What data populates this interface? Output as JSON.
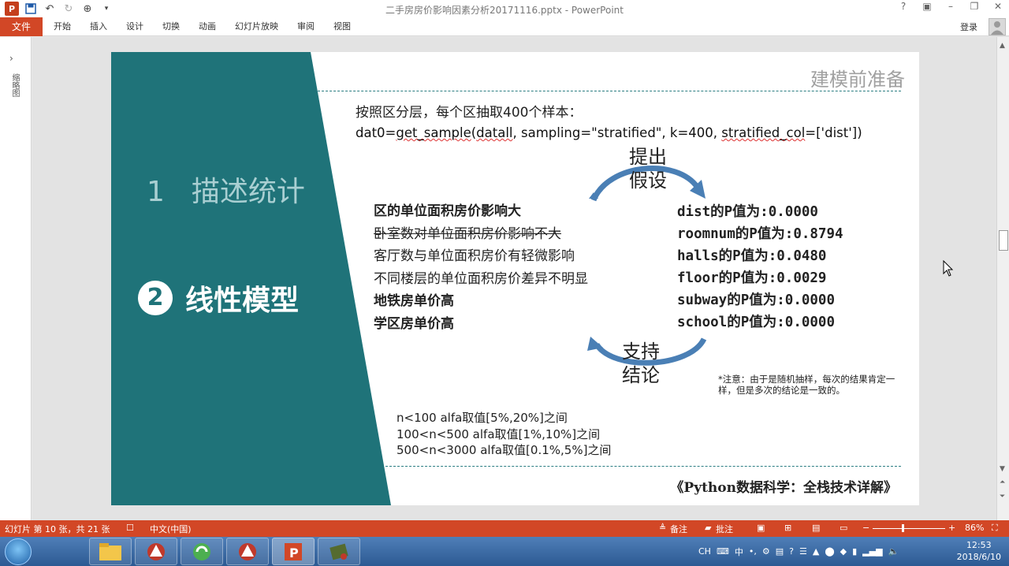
{
  "window": {
    "title": "二手房房价影响因素分析20171116.pptx - PowerPoint",
    "controls": [
      "?",
      "▣",
      "–",
      "❐",
      "✕"
    ]
  },
  "ribbon": {
    "file_tab": "文件",
    "tabs": [
      "开始",
      "插入",
      "设计",
      "切换",
      "动画",
      "幻灯片放映",
      "审阅",
      "视图"
    ],
    "login": "登录"
  },
  "left_pane": {
    "label": "缩略图"
  },
  "slide": {
    "heading": "建模前准备",
    "nav": [
      {
        "number": "1",
        "label": "描述统计"
      },
      {
        "number": "2",
        "label": "线性模型"
      }
    ],
    "intro": "按照区分层，每个区抽取400个样本：",
    "code": {
      "prefix": "dat0=",
      "fn": "get_sample",
      "open": "(",
      "arg1": "datall",
      "sep1": ", sampling=\"stratified\", k=400, ",
      "kw": "stratified_col",
      "rest": "=['dist'])"
    },
    "hypothesis": [
      "提出",
      "假设"
    ],
    "conclusion": [
      "支持",
      "结论"
    ],
    "findings": [
      "区的单位面积房价影响大",
      "卧室数对单位面积房价影响不大",
      "客厅数与单位面积房价有轻微影响",
      "不同楼层的单位面积房价差异不明显",
      "地铁房单价高",
      "学区房单价高"
    ],
    "p_values": [
      "dist的P值为:0.0000",
      "roomnum的P值为:0.8794",
      "halls的P值为:0.0480",
      "floor的P值为:0.0029",
      "subway的P值为:0.0000",
      "school的P值为:0.0000"
    ],
    "note": "*注意：由于是随机抽样，每次的结果肯定一样，但是多次的结论是一致的。",
    "alfa_rules": [
      "n<100 alfa取值[5%,20%]之间",
      "100<n<500 alfa取值[1%,10%]之间",
      "500<n<3000 alfa取值[0.1%,5%]之间"
    ],
    "book": "《Python数据科学：全栈技术详解》",
    "colors": {
      "teal": "#1f7379",
      "arrow": "#4a7fb5"
    }
  },
  "status_bar": {
    "slide_info": "幻灯片 第 10 张，共 21 张",
    "language": "中文(中国)",
    "notes": "备注",
    "comments": "批注",
    "zoom": "86%"
  },
  "taskbar": {
    "tray_ime": "CH",
    "tray_input": "中",
    "time": "12:53",
    "date": "2018/6/10"
  }
}
